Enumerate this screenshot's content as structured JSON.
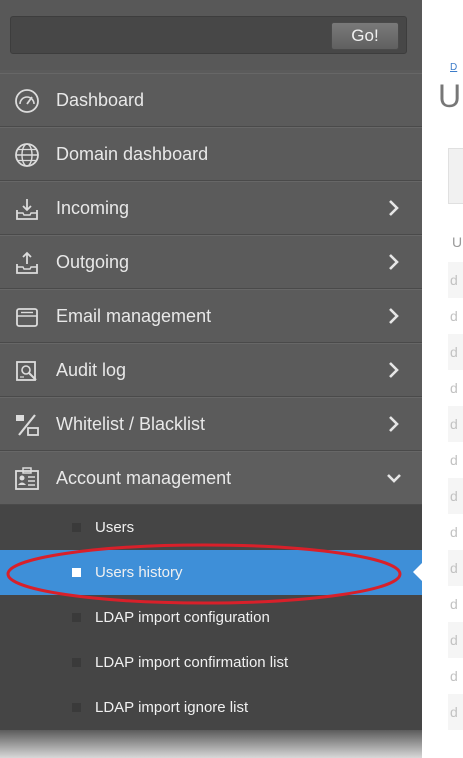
{
  "search": {
    "value": "",
    "placeholder": "",
    "go_label": "Go!"
  },
  "nav": {
    "items": [
      {
        "label": "Dashboard",
        "icon": "gauge-icon"
      },
      {
        "label": "Domain dashboard",
        "icon": "globe-icon"
      },
      {
        "label": "Incoming",
        "icon": "inbox-download-icon"
      },
      {
        "label": "Outgoing",
        "icon": "outbox-upload-icon"
      },
      {
        "label": "Email management",
        "icon": "envelope-tray-icon"
      },
      {
        "label": "Audit log",
        "icon": "audit-search-icon"
      },
      {
        "label": "Whitelist / Blacklist",
        "icon": "percent-list-icon"
      },
      {
        "label": "Account management",
        "icon": "id-card-icon"
      }
    ],
    "submenu": [
      {
        "label": "Users"
      },
      {
        "label": "Users history"
      },
      {
        "label": "LDAP import configuration"
      },
      {
        "label": "LDAP import confirmation list"
      },
      {
        "label": "LDAP import ignore list"
      }
    ]
  },
  "content": {
    "breadcrumb_fragment": "D",
    "title_fragment": "U",
    "column_header_fragment": "U",
    "row_fragments": [
      "d",
      "d",
      "d",
      "d",
      "d",
      "d",
      "d",
      "d",
      "d",
      "d",
      "d",
      "d",
      "d"
    ]
  },
  "colors": {
    "sidebar_bg": "#5b5b5b",
    "submenu_bg": "#454545",
    "active_item": "#3e8fd8",
    "annotation": "#d8202a",
    "link": "#3d7cc9"
  }
}
